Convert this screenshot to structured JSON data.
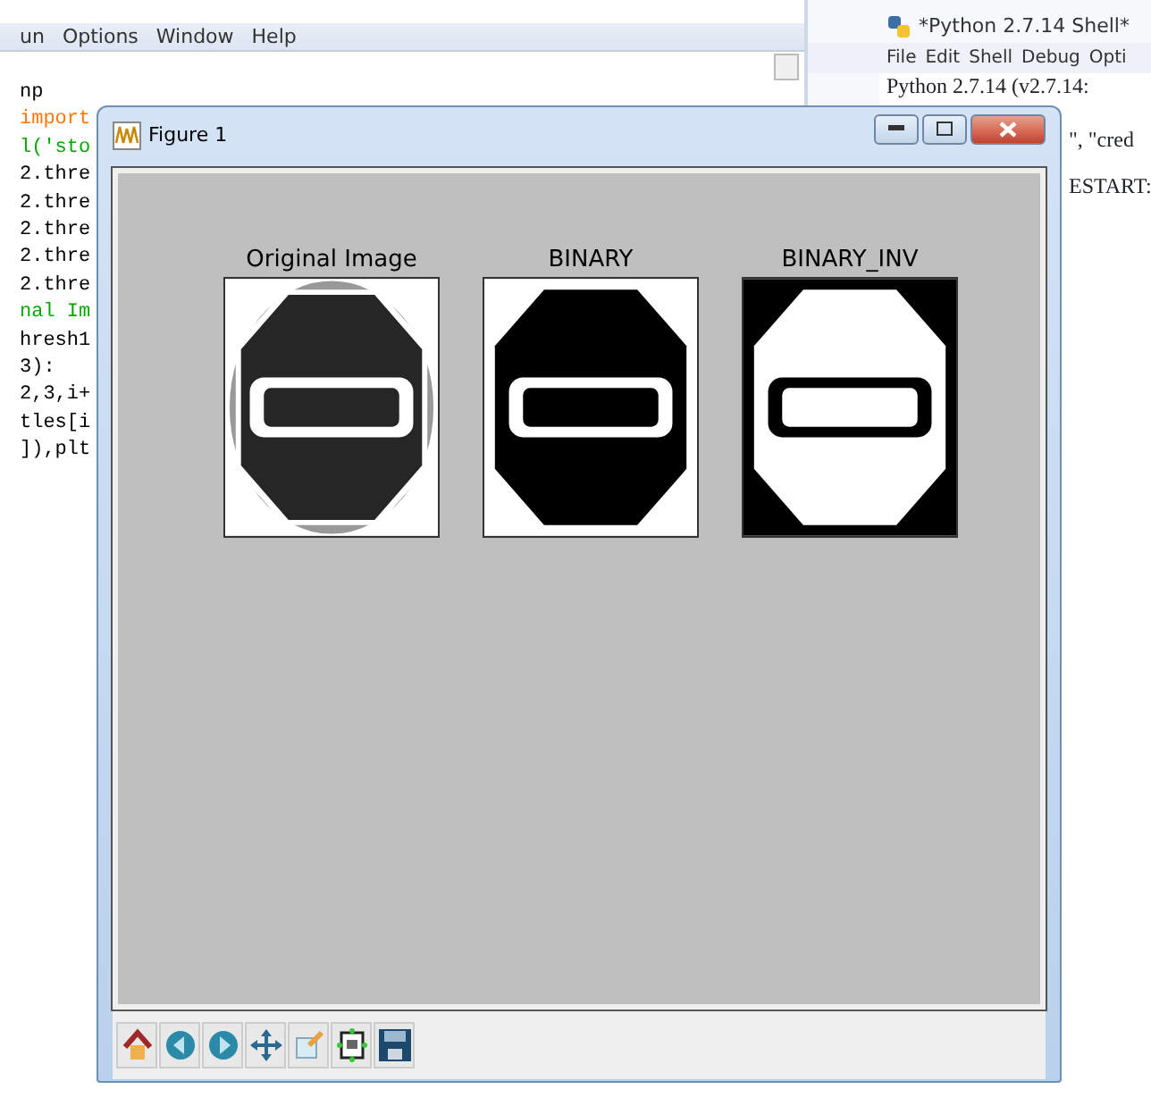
{
  "editor": {
    "menu": [
      "un",
      "Options",
      "Window",
      "Help"
    ],
    "lines": [
      {
        "text": "np",
        "color": "#000000"
      },
      {
        "text": "import",
        "color": "#ff7700"
      },
      {
        "text": "l('sto",
        "color": "#00aa00"
      },
      {
        "text": "2.thre",
        "color": "#000000"
      },
      {
        "text": "2.thre",
        "color": "#000000"
      },
      {
        "text": "2.thre",
        "color": "#000000"
      },
      {
        "text": "2.thre",
        "color": "#000000"
      },
      {
        "text": "2.thre",
        "color": "#000000"
      },
      {
        "text": "nal Im",
        "color": "#00aa00"
      },
      {
        "text": "hresh1",
        "color": "#000000"
      },
      {
        "text": "3):",
        "color": "#000000"
      },
      {
        "text": "2,3,i+",
        "color": "#000000"
      },
      {
        "text": "tles[i",
        "color": "#000000"
      },
      {
        "text": "]),plt",
        "color": "#000000"
      }
    ]
  },
  "shell": {
    "title": "*Python 2.7.14 Shell*",
    "menu": [
      "File",
      "Edit",
      "Shell",
      "Debug",
      "Opti"
    ],
    "lines": [
      "Python 2.7.14 (v2.7.14:",
      "\", \"cred",
      "ESTART:"
    ]
  },
  "figure": {
    "title": "Figure 1",
    "subplots": [
      {
        "title": "Original Image",
        "kind": "original"
      },
      {
        "title": "BINARY",
        "kind": "binary"
      },
      {
        "title": "BINARY_INV",
        "kind": "inverse"
      }
    ]
  }
}
